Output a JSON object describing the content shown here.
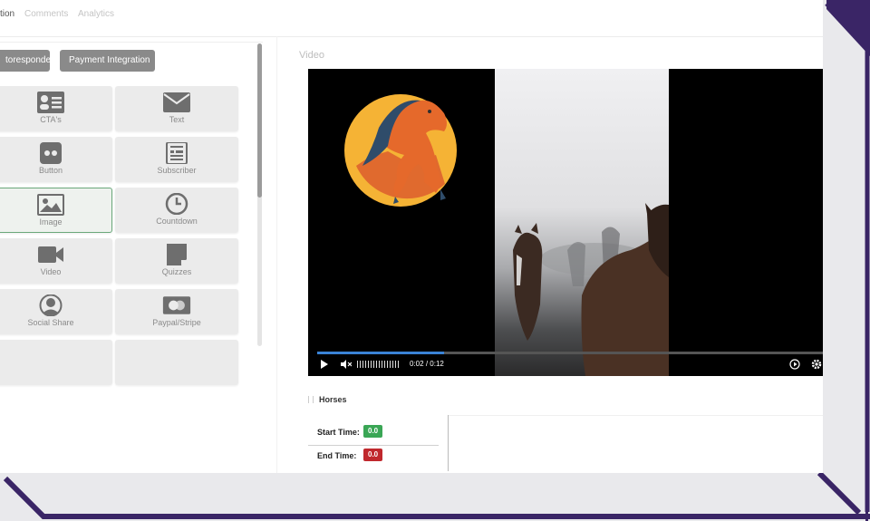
{
  "top_tabs": [
    {
      "label": "tion",
      "active": true
    },
    {
      "label": "Comments",
      "active": false
    },
    {
      "label": "Analytics",
      "active": false
    }
  ],
  "left_panel": {
    "buttons": [
      {
        "label": "toresponder"
      },
      {
        "label": "Payment Integration"
      }
    ],
    "elements": [
      {
        "label": "CTA's",
        "icon": "cta-icon"
      },
      {
        "label": "Text",
        "icon": "envelope-icon"
      },
      {
        "label": "Button",
        "icon": "button-icon"
      },
      {
        "label": "Subscriber",
        "icon": "subscriber-icon"
      },
      {
        "label": "Image",
        "icon": "image-icon",
        "selected": true
      },
      {
        "label": "Countdown",
        "icon": "clock-icon"
      },
      {
        "label": "Video",
        "icon": "video-camera-icon"
      },
      {
        "label": "Quizzes",
        "icon": "quiz-icon"
      },
      {
        "label": "Social Share",
        "icon": "user-circle-icon"
      },
      {
        "label": "Paypal/Stripe",
        "icon": "card-icon"
      }
    ]
  },
  "video": {
    "heading": "Video",
    "current_time": "0:02",
    "separator": "/",
    "duration": "0:12",
    "progress_fraction": 0.25
  },
  "timeline": {
    "title": "Horses",
    "start_label": "Start Time:",
    "start_value": "0.0",
    "end_label": "End Time:",
    "end_value": "0.0"
  },
  "colors": {
    "accent_blue": "#3a83d6",
    "start_badge": "#3aa655",
    "end_badge": "#c0282d",
    "frame_purple": "#3a2566",
    "selected_border": "#6aa87a"
  }
}
